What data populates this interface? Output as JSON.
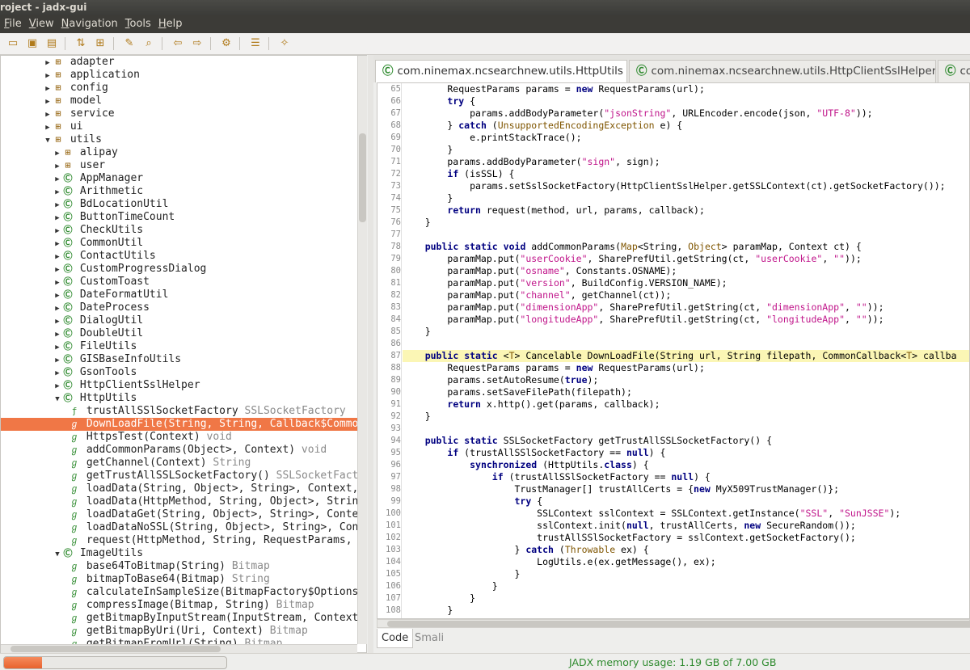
{
  "window": {
    "title": "roject - jadx-gui"
  },
  "menu": [
    "File",
    "View",
    "Navigation",
    "Tools",
    "Help"
  ],
  "toolbar_icons": [
    "open-icon",
    "save-icon",
    "save-all-icon",
    "sync-icon",
    "flatten-icon",
    "search-text-icon",
    "search-class-icon",
    "back-icon",
    "forward-icon",
    "deobfuscation-icon",
    "log-icon",
    "preferences-icon"
  ],
  "tree": [
    {
      "indent": 1,
      "arrow": "▶",
      "icon": "pkg",
      "label": "adapter",
      "rt": ""
    },
    {
      "indent": 1,
      "arrow": "▶",
      "icon": "pkg",
      "label": "application",
      "rt": ""
    },
    {
      "indent": 1,
      "arrow": "▶",
      "icon": "pkg",
      "label": "config",
      "rt": ""
    },
    {
      "indent": 1,
      "arrow": "▶",
      "icon": "pkg",
      "label": "model",
      "rt": ""
    },
    {
      "indent": 1,
      "arrow": "▶",
      "icon": "pkg",
      "label": "service",
      "rt": ""
    },
    {
      "indent": 1,
      "arrow": "▶",
      "icon": "pkg",
      "label": "ui",
      "rt": ""
    },
    {
      "indent": 1,
      "arrow": "▼",
      "icon": "pkg",
      "label": "utils",
      "rt": ""
    },
    {
      "indent": 2,
      "arrow": "▶",
      "icon": "pkg",
      "label": "alipay",
      "rt": ""
    },
    {
      "indent": 2,
      "arrow": "▶",
      "icon": "pkg",
      "label": "user",
      "rt": ""
    },
    {
      "indent": 2,
      "arrow": "▶",
      "icon": "cls",
      "label": "AppManager",
      "rt": ""
    },
    {
      "indent": 2,
      "arrow": "▶",
      "icon": "cls",
      "label": "Arithmetic",
      "rt": ""
    },
    {
      "indent": 2,
      "arrow": "▶",
      "icon": "cls",
      "label": "BdLocationUtil",
      "rt": ""
    },
    {
      "indent": 2,
      "arrow": "▶",
      "icon": "cls",
      "label": "ButtonTimeCount",
      "rt": ""
    },
    {
      "indent": 2,
      "arrow": "▶",
      "icon": "cls",
      "label": "CheckUtils",
      "rt": ""
    },
    {
      "indent": 2,
      "arrow": "▶",
      "icon": "cls",
      "label": "CommonUtil",
      "rt": ""
    },
    {
      "indent": 2,
      "arrow": "▶",
      "icon": "cls",
      "label": "ContactUtils",
      "rt": ""
    },
    {
      "indent": 2,
      "arrow": "▶",
      "icon": "cls",
      "label": "CustomProgressDialog",
      "rt": ""
    },
    {
      "indent": 2,
      "arrow": "▶",
      "icon": "cls",
      "label": "CustomToast",
      "rt": ""
    },
    {
      "indent": 2,
      "arrow": "▶",
      "icon": "cls",
      "label": "DateFormatUtil",
      "rt": ""
    },
    {
      "indent": 2,
      "arrow": "▶",
      "icon": "cls",
      "label": "DateProcess",
      "rt": ""
    },
    {
      "indent": 2,
      "arrow": "▶",
      "icon": "cls",
      "label": "DialogUtil",
      "rt": ""
    },
    {
      "indent": 2,
      "arrow": "▶",
      "icon": "cls",
      "label": "DoubleUtil",
      "rt": ""
    },
    {
      "indent": 2,
      "arrow": "▶",
      "icon": "cls",
      "label": "FileUtils",
      "rt": ""
    },
    {
      "indent": 2,
      "arrow": "▶",
      "icon": "cls",
      "label": "GISBaseInfoUtils",
      "rt": ""
    },
    {
      "indent": 2,
      "arrow": "▶",
      "icon": "cls",
      "label": "GsonTools",
      "rt": ""
    },
    {
      "indent": 2,
      "arrow": "▶",
      "icon": "cls",
      "label": "HttpClientSslHelper",
      "rt": ""
    },
    {
      "indent": 2,
      "arrow": "▼",
      "icon": "cls",
      "label": "HttpUtils",
      "rt": ""
    },
    {
      "indent": 3,
      "arrow": "",
      "icon": "fld",
      "label": "trustAllSSlSocketFactory",
      "rt": "SSLSocketFactory"
    },
    {
      "indent": 3,
      "arrow": "",
      "icon": "mth",
      "label": "DownLoadFile(String, String, Callback$CommonCallback)",
      "rt": "",
      "selected": true
    },
    {
      "indent": 3,
      "arrow": "",
      "icon": "mth",
      "label": "HttpsTest(Context)",
      "rt": "void"
    },
    {
      "indent": 3,
      "arrow": "",
      "icon": "mth",
      "label": "addCommonParams(Object>, Context)",
      "rt": "void"
    },
    {
      "indent": 3,
      "arrow": "",
      "icon": "mth",
      "label": "getChannel(Context)",
      "rt": "String"
    },
    {
      "indent": 3,
      "arrow": "",
      "icon": "mth",
      "label": "getTrustAllSSLSocketFactory()",
      "rt": "SSLSocketFactory"
    },
    {
      "indent": 3,
      "arrow": "",
      "icon": "mth",
      "label": "loadData(String, Object>, String>, Context, Callback)",
      "rt": ""
    },
    {
      "indent": 3,
      "arrow": "",
      "icon": "mth",
      "label": "loadData(HttpMethod, String, Object>, String>)",
      "rt": ""
    },
    {
      "indent": 3,
      "arrow": "",
      "icon": "mth",
      "label": "loadDataGet(String, Object>, String>, Context)",
      "rt": ""
    },
    {
      "indent": 3,
      "arrow": "",
      "icon": "mth",
      "label": "loadDataNoSSL(String, Object>, String>, Context)",
      "rt": ""
    },
    {
      "indent": 3,
      "arrow": "",
      "icon": "mth",
      "label": "request(HttpMethod, String, RequestParams, Callback)",
      "rt": ""
    },
    {
      "indent": 2,
      "arrow": "▼",
      "icon": "cls",
      "label": "ImageUtils",
      "rt": ""
    },
    {
      "indent": 3,
      "arrow": "",
      "icon": "mth",
      "label": "base64ToBitmap(String)",
      "rt": "Bitmap"
    },
    {
      "indent": 3,
      "arrow": "",
      "icon": "mth",
      "label": "bitmapToBase64(Bitmap)",
      "rt": "String"
    },
    {
      "indent": 3,
      "arrow": "",
      "icon": "mth",
      "label": "calculateInSampleSize(BitmapFactory$Options, int, int)",
      "rt": ""
    },
    {
      "indent": 3,
      "arrow": "",
      "icon": "mth",
      "label": "compressImage(Bitmap, String)",
      "rt": "Bitmap"
    },
    {
      "indent": 3,
      "arrow": "",
      "icon": "mth",
      "label": "getBitmapByInputStream(InputStream, Context)",
      "rt": ""
    },
    {
      "indent": 3,
      "arrow": "",
      "icon": "mth",
      "label": "getBitmapByUri(Uri, Context)",
      "rt": "Bitmap"
    },
    {
      "indent": 3,
      "arrow": "",
      "icon": "mth",
      "label": "getBitmapFromUrl(String)",
      "rt": "Bitmap"
    }
  ],
  "tabs": [
    {
      "label": "com.ninemax.ncsearchnew.utils.HttpUtils",
      "active": true
    },
    {
      "label": "com.ninemax.ncsearchnew.utils.HttpClientSslHelper",
      "active": false
    },
    {
      "label": "co",
      "active": false
    }
  ],
  "code_lines": [
    {
      "n": "65",
      "t": "        RequestParams params = new RequestParams(url);"
    },
    {
      "n": "66",
      "t": "        try {"
    },
    {
      "n": "67",
      "t": "            params.addBodyParameter(\"jsonString\", URLEncoder.encode(json, \"UTF-8\"));"
    },
    {
      "n": "68",
      "t": "        } catch (UnsupportedEncodingException e) {"
    },
    {
      "n": "69",
      "t": "            e.printStackTrace();"
    },
    {
      "n": "70",
      "t": "        }"
    },
    {
      "n": "71",
      "t": "        params.addBodyParameter(\"sign\", sign);"
    },
    {
      "n": "72",
      "t": "        if (isSSL) {"
    },
    {
      "n": "73",
      "t": "            params.setSslSocketFactory(HttpClientSslHelper.getSSLContext(ct).getSocketFactory());"
    },
    {
      "n": "74",
      "t": "        }"
    },
    {
      "n": "75",
      "t": "        return request(method, url, params, callback);"
    },
    {
      "n": "76",
      "t": "    }"
    },
    {
      "n": "77",
      "t": ""
    },
    {
      "n": "78",
      "t": "    public static void addCommonParams(Map<String, Object> paramMap, Context ct) {"
    },
    {
      "n": "79",
      "t": "        paramMap.put(\"userCookie\", SharePrefUtil.getString(ct, \"userCookie\", \"\"));"
    },
    {
      "n": "80",
      "t": "        paramMap.put(\"osname\", Constants.OSNAME);"
    },
    {
      "n": "81",
      "t": "        paramMap.put(\"version\", BuildConfig.VERSION_NAME);"
    },
    {
      "n": "82",
      "t": "        paramMap.put(\"channel\", getChannel(ct));"
    },
    {
      "n": "83",
      "t": "        paramMap.put(\"dimensionApp\", SharePrefUtil.getString(ct, \"dimensionApp\", \"\"));"
    },
    {
      "n": "84",
      "t": "        paramMap.put(\"longitudeApp\", SharePrefUtil.getString(ct, \"longitudeApp\", \"\"));"
    },
    {
      "n": "85",
      "t": "    }"
    },
    {
      "n": "86",
      "t": ""
    },
    {
      "n": "87",
      "t": "    public static <T> Cancelable DownLoadFile(String url, String filepath, CommonCallback<T> callba",
      "hl": true
    },
    {
      "n": "88",
      "t": "        RequestParams params = new RequestParams(url);"
    },
    {
      "n": "89",
      "t": "        params.setAutoResume(true);"
    },
    {
      "n": "90",
      "t": "        params.setSaveFilePath(filepath);"
    },
    {
      "n": "91",
      "t": "        return x.http().get(params, callback);"
    },
    {
      "n": "92",
      "t": "    }"
    },
    {
      "n": "93",
      "t": ""
    },
    {
      "n": "94",
      "t": "    public static SSLSocketFactory getTrustAllSSLSocketFactory() {"
    },
    {
      "n": "95",
      "t": "        if (trustAllSSlSocketFactory == null) {"
    },
    {
      "n": "96",
      "t": "            synchronized (HttpUtils.class) {"
    },
    {
      "n": "97",
      "t": "                if (trustAllSSlSocketFactory == null) {"
    },
    {
      "n": "98",
      "t": "                    TrustManager[] trustAllCerts = {new MyX509TrustManager()};"
    },
    {
      "n": "99",
      "t": "                    try {"
    },
    {
      "n": "100",
      "t": "                        SSLContext sslContext = SSLContext.getInstance(\"SSL\", \"SunJSSE\");"
    },
    {
      "n": "101",
      "t": "                        sslContext.init(null, trustAllCerts, new SecureRandom());"
    },
    {
      "n": "102",
      "t": "                        trustAllSSlSocketFactory = sslContext.getSocketFactory();"
    },
    {
      "n": "103",
      "t": "                    } catch (Throwable ex) {"
    },
    {
      "n": "104",
      "t": "                        LogUtils.e(ex.getMessage(), ex);"
    },
    {
      "n": "105",
      "t": "                    }"
    },
    {
      "n": "106",
      "t": "                }"
    },
    {
      "n": "107",
      "t": "            }"
    },
    {
      "n": "108",
      "t": "        }"
    }
  ],
  "bottom_tabs": {
    "code": "Code",
    "smali": "Smali"
  },
  "status": {
    "memory_text": "JADX memory usage: 1.19 GB of 7.00 GB",
    "memory_fraction": 0.17,
    "color": "#2e8a2e"
  }
}
